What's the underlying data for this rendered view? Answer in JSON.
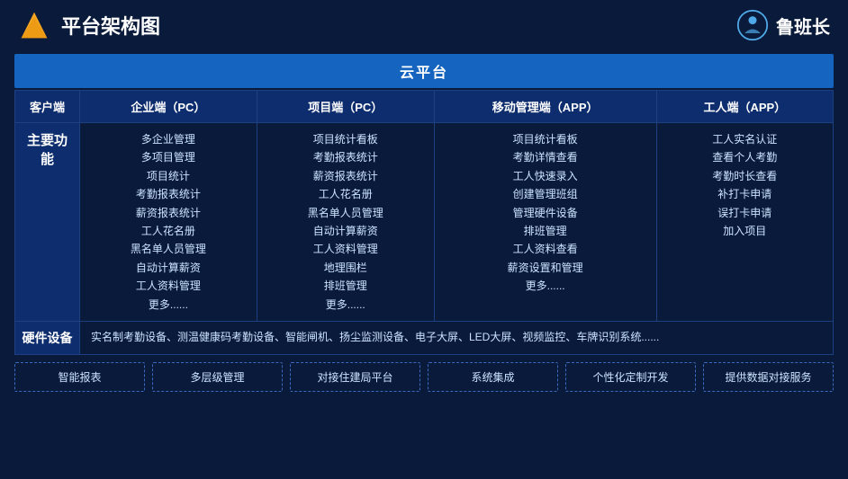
{
  "header": {
    "title": "平台架构图",
    "brand": "鲁班长"
  },
  "cloud_platform": {
    "label": "云平台"
  },
  "columns": [
    {
      "id": "client",
      "label": "客户端"
    },
    {
      "id": "enterprise_pc",
      "label": "企业端（PC）"
    },
    {
      "id": "project_pc",
      "label": "项目端（PC）"
    },
    {
      "id": "mobile_app",
      "label": "移动管理端（APP）"
    },
    {
      "id": "worker_app",
      "label": "工人端（APP）"
    }
  ],
  "main_functions": {
    "row_label": "主要功能",
    "enterprise_pc": [
      "多企业管理",
      "多项目管理",
      "项目统计",
      "考勤报表统计",
      "薪资报表统计",
      "工人花名册",
      "黑名单人员管理",
      "自动计算薪资",
      "工人资料管理",
      "更多......"
    ],
    "project_pc": [
      "项目统计看板",
      "考勤报表统计",
      "薪资报表统计",
      "工人花名册",
      "黑名单人员管理",
      "自动计算薪资",
      "工人资料管理",
      "地理围栏",
      "排班管理",
      "更多......"
    ],
    "mobile_app": [
      "项目统计看板",
      "考勤详情查看",
      "工人快速录入",
      "创建管理班组",
      "管理硬件设备",
      "排班管理",
      "工人资料查看",
      "薪资设置和管理",
      "更多......"
    ],
    "worker_app": [
      "工人实名认证",
      "查看个人考勤",
      "考勤时长查看",
      "补打卡申请",
      "误打卡申请",
      "加入项目"
    ]
  },
  "hardware": {
    "row_label": "硬件设备",
    "content": "实名制考勤设备、测温健康码考勤设备、智能闸机、扬尘监测设备、电子大屏、LED大屏、视频监控、车牌识别系统......"
  },
  "bottom_items": [
    "智能报表",
    "多层级管理",
    "对接住建局平台",
    "系统集成",
    "个性化定制开发",
    "提供数据对接服务"
  ]
}
